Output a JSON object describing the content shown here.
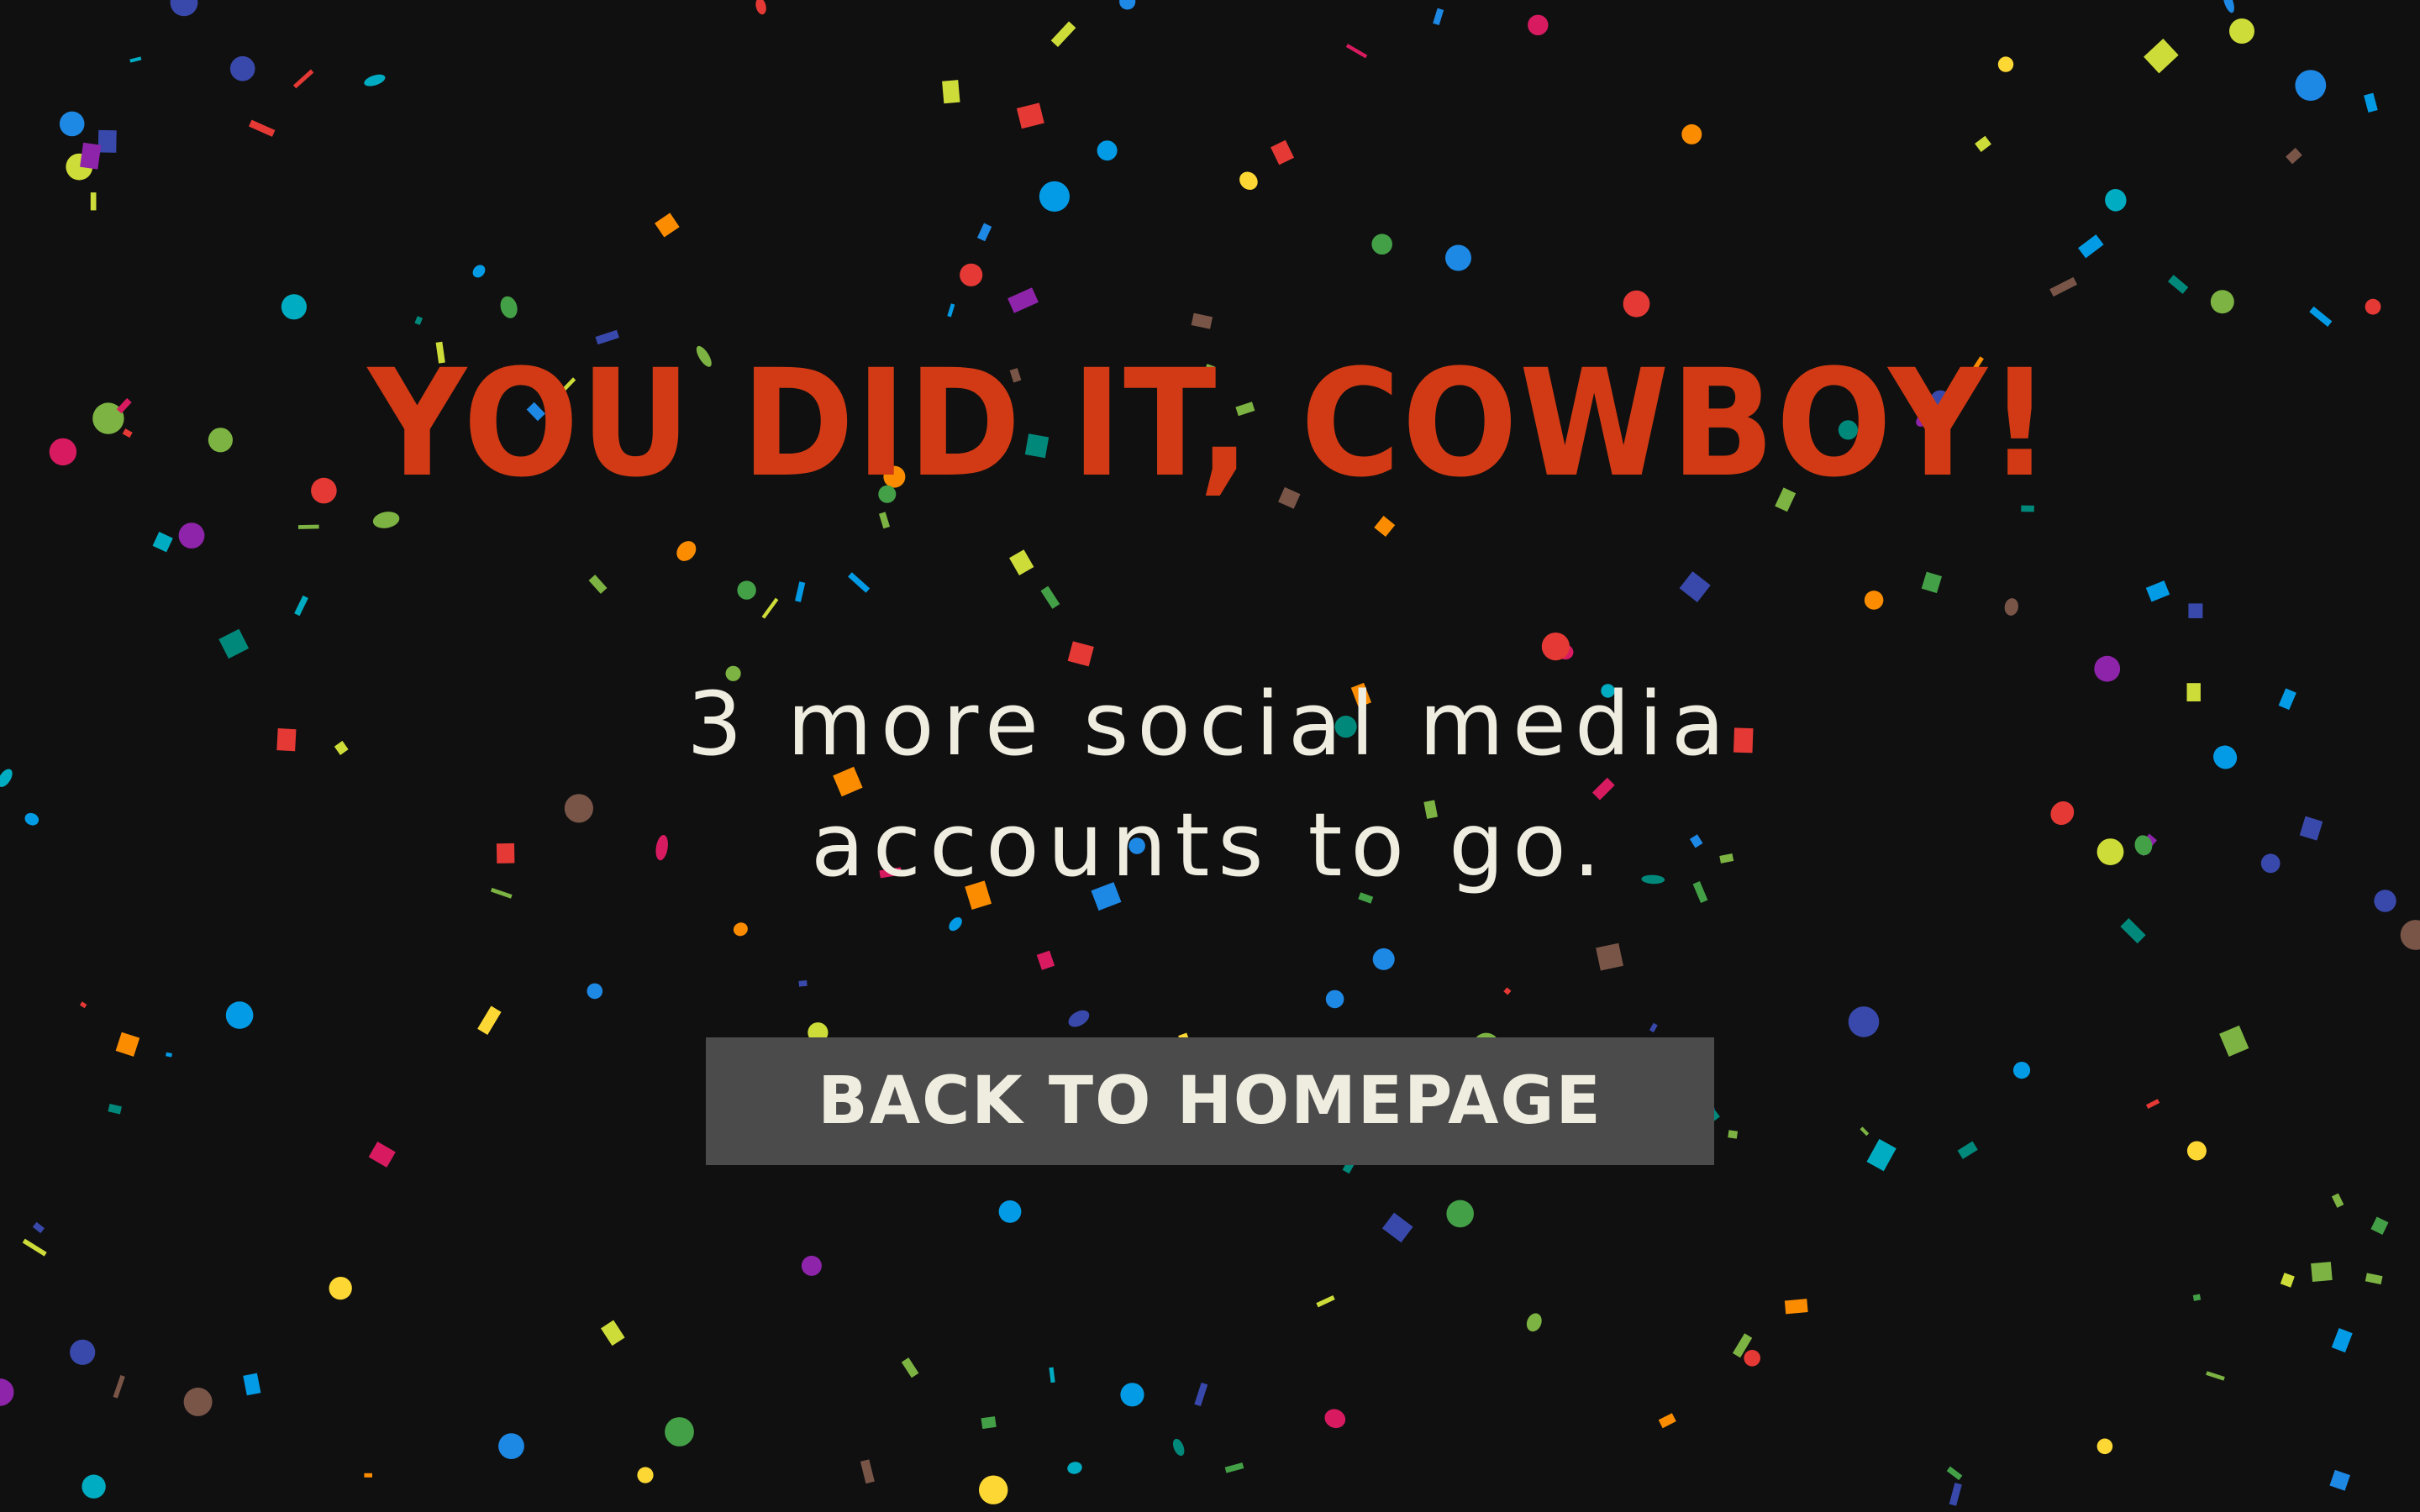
{
  "page": {
    "background": "#101010"
  },
  "headline": {
    "text": "YOU DID IT, COWBOY!",
    "color": "#d13a14"
  },
  "subtitle": {
    "line1": "3 more social media",
    "line2": "accounts to go.",
    "color": "#efece0"
  },
  "home_button": {
    "label": "BACK TO HOMEPAGE",
    "background": "#4b4b4b",
    "text_color": "#efece0"
  },
  "confetti": {
    "colors": [
      "#e53935",
      "#1e88e5",
      "#43a047",
      "#fdd835",
      "#8e24aa",
      "#fb8c00",
      "#00acc1",
      "#d81b60",
      "#3949ab",
      "#7cb342",
      "#795548",
      "#039be5",
      "#cddc39",
      "#00897b"
    ]
  }
}
